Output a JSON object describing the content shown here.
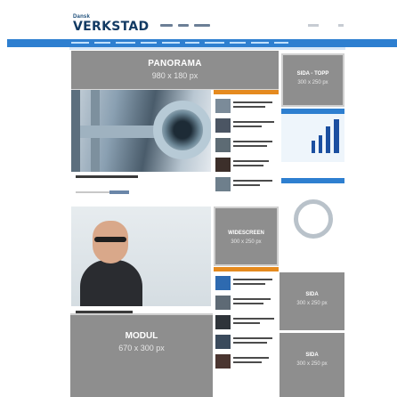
{
  "header": {
    "logo_small": "Dansk",
    "logo_main": "VERKSTAD"
  },
  "ads": {
    "panorama": {
      "title": "PANORAMA",
      "size": "980 x 180 px"
    },
    "sida_topp": {
      "title": "SIDA - TOPP",
      "size": "300 x 250 px"
    },
    "widescreen": {
      "title": "WIDESCREEN",
      "size": "300 x 250 px"
    },
    "sida_1": {
      "title": "SIDA",
      "size": "300 x 250 px"
    },
    "sida_2": {
      "title": "SIDA",
      "size": "300 x 250 px"
    },
    "modul": {
      "title": "MODUL",
      "size": "670 x 300 px"
    }
  },
  "colors": {
    "brand_blue": "#2e7fd0",
    "accent_orange": "#e58a1f",
    "ad_gray": "#8e8e8e"
  }
}
